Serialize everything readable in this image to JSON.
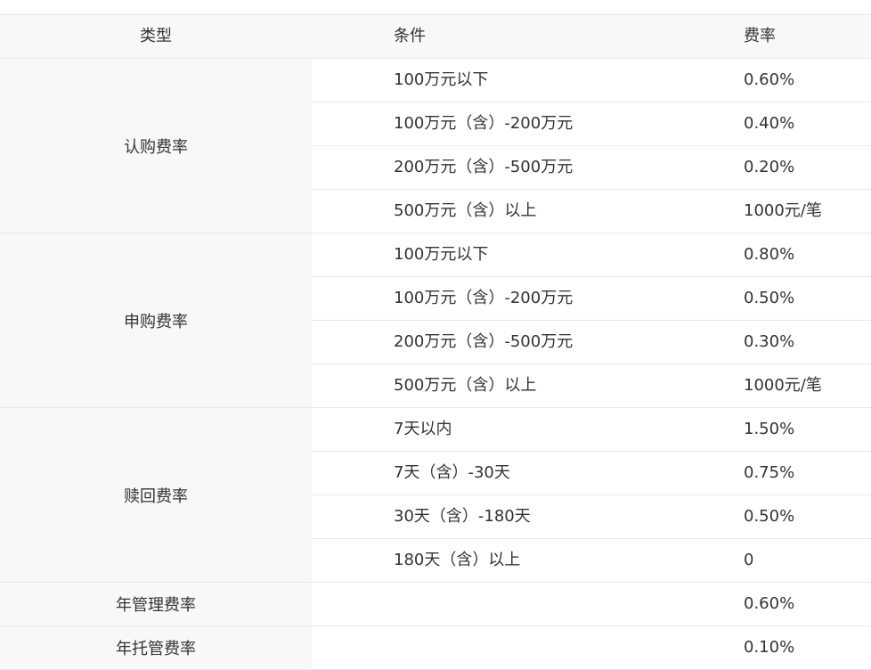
{
  "table": {
    "headers": {
      "type": "类型",
      "condition": "条件",
      "rate": "费率"
    },
    "groups": [
      {
        "type": "认购费率",
        "rows": [
          {
            "condition": "100万元以下",
            "rate": "0.60%"
          },
          {
            "condition": "100万元（含）-200万元",
            "rate": "0.40%"
          },
          {
            "condition": "200万元（含）-500万元",
            "rate": "0.20%"
          },
          {
            "condition": "500万元（含）以上",
            "rate": "1000元/笔"
          }
        ]
      },
      {
        "type": "申购费率",
        "rows": [
          {
            "condition": "100万元以下",
            "rate": "0.80%"
          },
          {
            "condition": "100万元（含）-200万元",
            "rate": "0.50%"
          },
          {
            "condition": "200万元（含）-500万元",
            "rate": "0.30%"
          },
          {
            "condition": "500万元（含）以上",
            "rate": "1000元/笔"
          }
        ]
      },
      {
        "type": "赎回费率",
        "rows": [
          {
            "condition": "7天以内",
            "rate": "1.50%"
          },
          {
            "condition": "7天（含）-30天",
            "rate": "0.75%"
          },
          {
            "condition": "30天（含）-180天",
            "rate": "0.50%"
          },
          {
            "condition": "180天（含）以上",
            "rate": "0"
          }
        ]
      },
      {
        "type": "年管理费率",
        "rows": [
          {
            "condition": "",
            "rate": "0.60%"
          }
        ]
      },
      {
        "type": "年托管费率",
        "rows": [
          {
            "condition": "",
            "rate": "0.10%"
          }
        ]
      }
    ]
  }
}
